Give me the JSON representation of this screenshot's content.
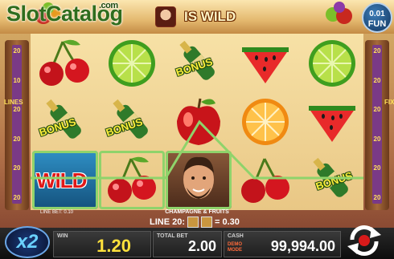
{
  "header": {
    "logo_main": "SlotCatalog",
    "logo_com": ".com",
    "wild_title": "IS WILD",
    "fun_line1": "0.01",
    "fun_line2": "FUN"
  },
  "paylines": {
    "left_numbers": [
      "20",
      "10",
      "20",
      "20",
      "20",
      "20"
    ],
    "right_numbers": [
      "20",
      "20",
      "20",
      "20",
      "20",
      "20"
    ],
    "left_word": "LINES",
    "right_word": "FIXED"
  },
  "reels": {
    "wild_label": "WILD",
    "bonus_label": "BONUS",
    "symbols": [
      [
        "cherries",
        "bottle",
        "wild"
      ],
      [
        "lime",
        "bottle",
        "cherries"
      ],
      [
        "bottle",
        "apple",
        "man"
      ],
      [
        "watermelon",
        "orange",
        "cherries"
      ],
      [
        "lime",
        "watermelon",
        "bottle"
      ]
    ]
  },
  "info": {
    "line_bet": "LINE BET: 0.10",
    "game_name": "CHAMPAGNE & FRUITS",
    "line_label": "LINE 20:",
    "line_win": "= 0.30"
  },
  "bottom": {
    "multiplier": "x2",
    "win_label": "WIN",
    "win_value": "1.20",
    "total_bet_label": "TOTAL BET",
    "total_bet_value": "2.00",
    "cash_label": "CASH",
    "demo_label": "DEMO\nMODE",
    "cash_value": "99,994.00"
  },
  "colors": {
    "highlight": "#8fd36b",
    "win_value": "#ffe23c",
    "rail_strip": "#7a3a86"
  },
  "icons": [
    "spin-arrows-icon",
    "wild-face-icon"
  ]
}
